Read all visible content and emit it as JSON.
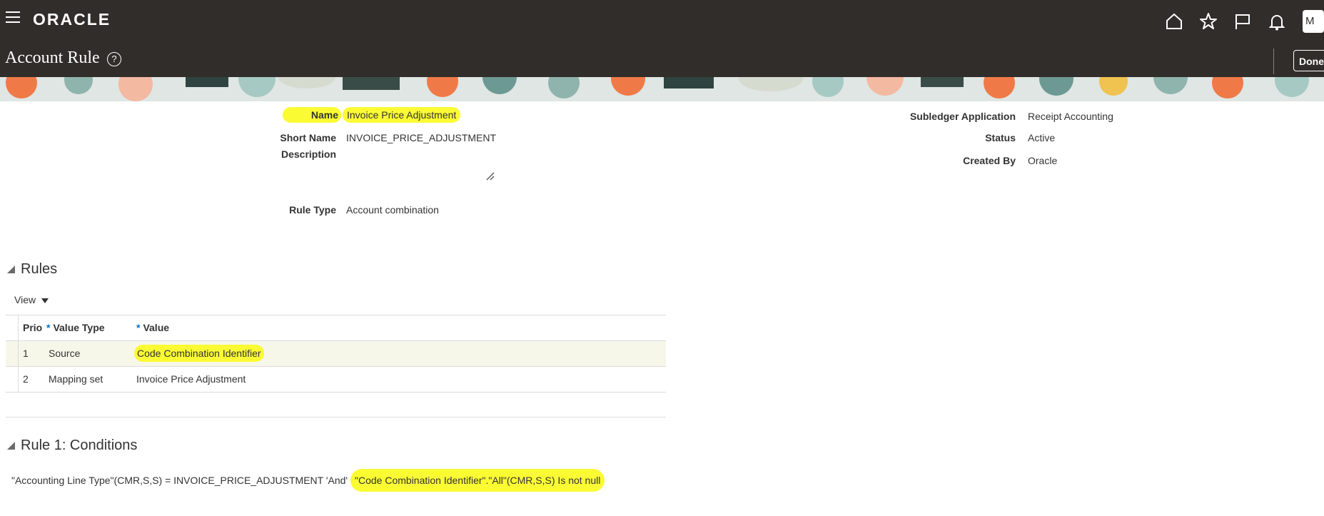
{
  "header": {
    "logo_text": "ORACLE",
    "page_title": "Account Rule",
    "done_label": "Done",
    "avatar_initial": "M",
    "icons": [
      "menu-icon",
      "home-icon",
      "star-icon",
      "flag-icon",
      "bell-icon",
      "help-icon"
    ]
  },
  "form": {
    "name_label": "Name",
    "name_value": "Invoice Price Adjustment",
    "short_name_label": "Short Name",
    "short_name_value": "INVOICE_PRICE_ADJUSTMENT",
    "description_label": "Description",
    "description_value": "",
    "rule_type_label": "Rule Type",
    "rule_type_value": "Account combination",
    "subledger_label": "Subledger Application",
    "subledger_value": "Receipt Accounting",
    "status_label": "Status",
    "status_value": "Active",
    "created_by_label": "Created By",
    "created_by_value": "Oracle"
  },
  "rules": {
    "section_title": "Rules",
    "view_label": "View",
    "columns": [
      "Prio",
      "Value Type",
      "Value"
    ],
    "required_marker": "*",
    "rows": [
      {
        "prio": "1",
        "value_type": "Source",
        "value": "Code Combination Identifier"
      },
      {
        "prio": "2",
        "value_type": "Mapping set",
        "value": "Invoice Price Adjustment"
      }
    ]
  },
  "conditions": {
    "section_title": "Rule 1: Conditions",
    "text_part1": "\"Accounting Line Type\"(CMR,S,S) = INVOICE_PRICE_ADJUSTMENT 'And' ",
    "text_part2": "\"Code Combination Identifier\".\"All\"(CMR,S,S) Is not null"
  },
  "colors": {
    "header_bg": "#312d2a",
    "highlight": "#fbfb34",
    "required": "#0572ce"
  }
}
